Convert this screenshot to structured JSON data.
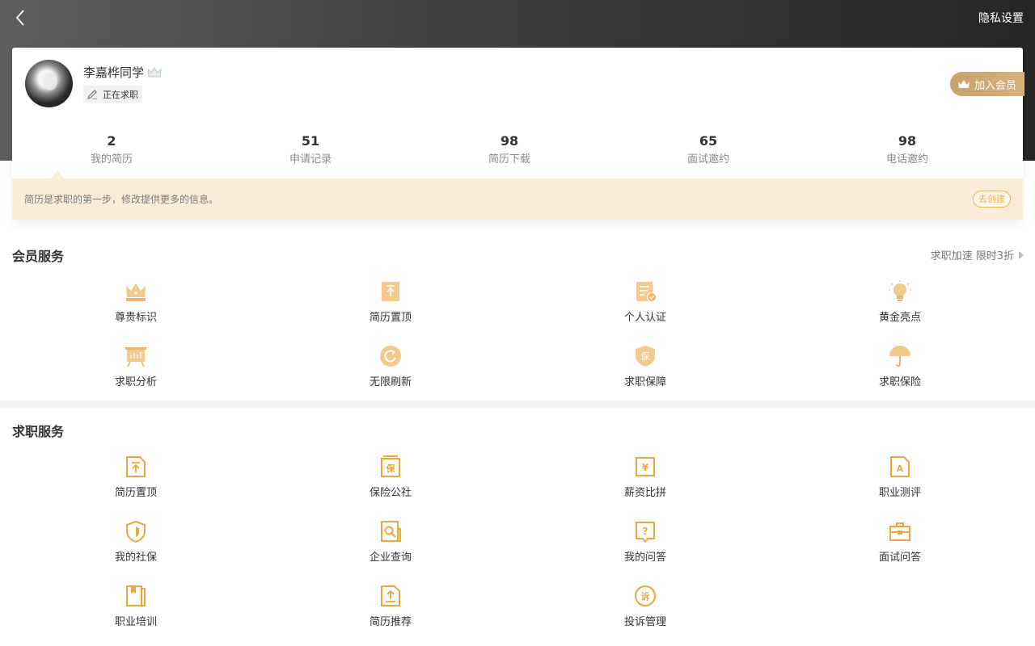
{
  "header": {
    "privacy_label": "隐私设置"
  },
  "profile": {
    "name": "李嘉桦同学",
    "status": "正在求职",
    "join_vip": "加入会员"
  },
  "stats": [
    {
      "value": "2",
      "label": "我的简历"
    },
    {
      "value": "51",
      "label": "申请记录"
    },
    {
      "value": "98",
      "label": "简历下载"
    },
    {
      "value": "65",
      "label": "面试邀约"
    },
    {
      "value": "98",
      "label": "电话邀约"
    }
  ],
  "tip": {
    "text": "简历是求职的第一步，修改提供更多的信息。",
    "button": "去创建"
  },
  "vip_services": {
    "title": "会员服务",
    "promo": "求职加速 限时3折",
    "items": [
      {
        "label": "尊贵标识",
        "icon": "crown-icon"
      },
      {
        "label": "简历置顶",
        "icon": "pin-top-icon"
      },
      {
        "label": "个人认证",
        "icon": "verify-doc-icon"
      },
      {
        "label": "黄金亮点",
        "icon": "lightbulb-icon"
      },
      {
        "label": "求职分析",
        "icon": "analysis-board-icon"
      },
      {
        "label": "无限刷新",
        "icon": "refresh-icon"
      },
      {
        "label": "求职保障",
        "icon": "shield-bao-icon"
      },
      {
        "label": "求职保险",
        "icon": "umbrella-icon"
      }
    ]
  },
  "job_services": {
    "title": "求职服务",
    "items": [
      {
        "label": "简历置顶",
        "icon": "resume-top-icon"
      },
      {
        "label": "保险公社",
        "icon": "insurance-icon"
      },
      {
        "label": "薪资比拼",
        "icon": "salary-icon"
      },
      {
        "label": "职业测评",
        "icon": "career-test-icon"
      },
      {
        "label": "我的社保",
        "icon": "social-security-icon"
      },
      {
        "label": "企业查询",
        "icon": "company-search-icon"
      },
      {
        "label": "我的问答",
        "icon": "qa-icon"
      },
      {
        "label": "面试问答",
        "icon": "interview-briefcase-icon"
      },
      {
        "label": "职业培训",
        "icon": "training-book-icon"
      },
      {
        "label": "简历推荐",
        "icon": "resume-upload-icon"
      },
      {
        "label": "投诉管理",
        "icon": "complaint-icon"
      }
    ]
  },
  "colors": {
    "accent": "#f0a53c",
    "gold": "#c9a26a",
    "tip_bg": "#faecd8"
  }
}
